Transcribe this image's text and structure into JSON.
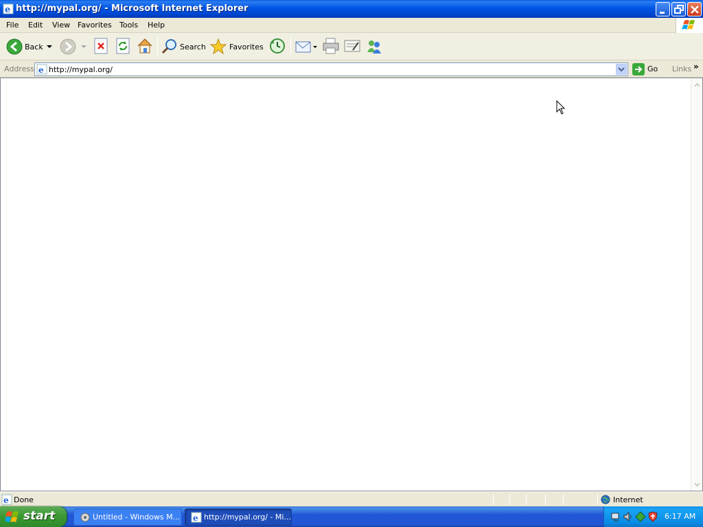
{
  "window": {
    "title": "http://mypal.org/ - Microsoft Internet Explorer"
  },
  "menu": {
    "items": [
      "File",
      "Edit",
      "View",
      "Favorites",
      "Tools",
      "Help"
    ]
  },
  "toolbar": {
    "back_label": "Back",
    "search_label": "Search",
    "favorites_label": "Favorites"
  },
  "address": {
    "label": "Address",
    "url": "http://mypal.org/",
    "go_label": "Go",
    "links_label": "Links"
  },
  "status": {
    "text": "Done",
    "zone": "Internet"
  },
  "taskbar": {
    "start_label": "start",
    "tasks": [
      {
        "label": "Untitled - Windows M..."
      },
      {
        "label": "http://mypal.org/ - Mi..."
      }
    ],
    "clock": "6:17 AM"
  },
  "colors": {
    "titlebar": "#0055e5",
    "taskbar": "#2157d7",
    "start": "#3c9a35",
    "tray": "#0c8ae4"
  }
}
